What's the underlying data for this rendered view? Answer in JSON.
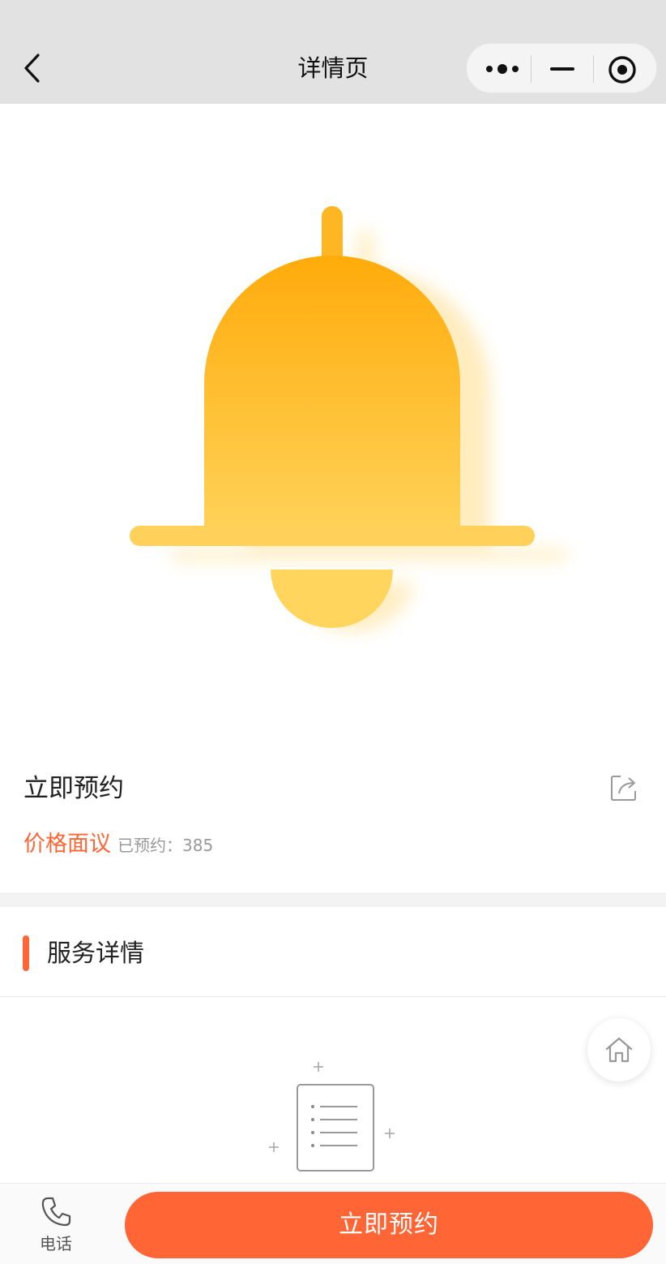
{
  "navbar": {
    "title": "详情页",
    "icons": [
      "back-chevron-icon",
      "more-dots-icon",
      "minimize-icon",
      "close-target-icon"
    ]
  },
  "hero": {
    "image": "bell-icon",
    "colors": {
      "top": "#ffab0b",
      "bottom": "#ffd258",
      "clapper": "#ffd55e"
    }
  },
  "product": {
    "title": "立即预约",
    "price": "价格面议",
    "booked_label": "已预约：",
    "booked_count": "385",
    "share_icon": "share-icon"
  },
  "section": {
    "title": "服务详情",
    "empty_icon": "empty-document-icon"
  },
  "float": {
    "home_icon": "home-icon"
  },
  "bottom": {
    "phone_label": "电话",
    "phone_icon": "phone-icon",
    "book_label": "立即预约"
  },
  "colors": {
    "accent": "#ff6535",
    "navbar_bg": "#e2e2e2"
  }
}
